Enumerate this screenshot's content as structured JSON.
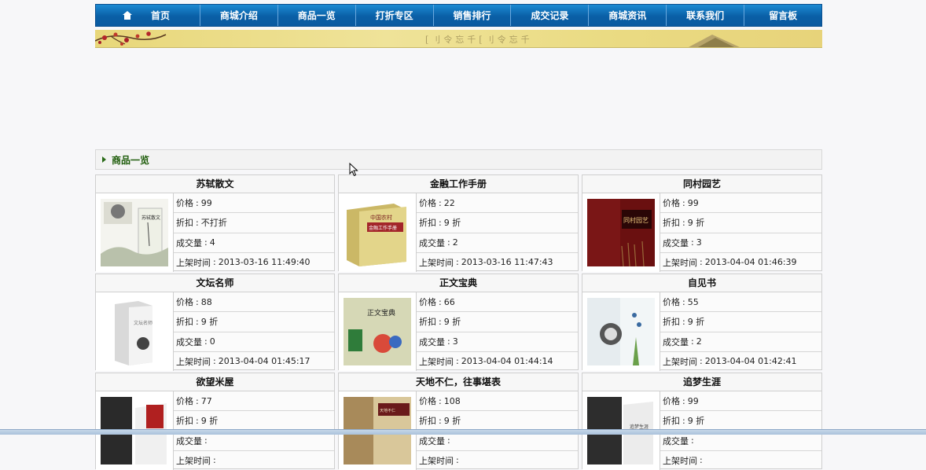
{
  "nav": {
    "items": [
      {
        "label": "首页",
        "icon": "home-icon"
      },
      {
        "label": "商城介绍"
      },
      {
        "label": "商品一览"
      },
      {
        "label": "打折专区"
      },
      {
        "label": "销售排行"
      },
      {
        "label": "成交记录"
      },
      {
        "label": "商城资讯"
      },
      {
        "label": "联系我们"
      },
      {
        "label": "留言板"
      }
    ],
    "color": "#0a5fa6"
  },
  "banner": {
    "motto": "[刂令忘千[刂令忘千"
  },
  "section": {
    "title": "商品一览",
    "icon": "arrow-right-icon"
  },
  "labels": {
    "price": "价格",
    "discount": "折扣",
    "sold": "成交量",
    "listed": "上架时间",
    "sep": ":"
  },
  "products": [
    {
      "title": "苏轼散文",
      "price": "99",
      "discount": "不打折",
      "sold": "4",
      "listed": "2013-03-16 11:49:40",
      "cover": "ink-landscape"
    },
    {
      "title": "金融工作手册",
      "price": "22",
      "discount": "9 折",
      "sold": "2",
      "listed": "2013-03-16 11:47:43",
      "cover": "yellow-book"
    },
    {
      "title": "同村园艺",
      "price": "99",
      "discount": "9 折",
      "sold": "3",
      "listed": "2013-04-04 01:46:39",
      "cover": "red-book"
    },
    {
      "title": "文坛名师",
      "price": "88",
      "discount": "9 折",
      "sold": "0",
      "listed": "2013-04-04 01:45:17",
      "cover": "white-book"
    },
    {
      "title": "正文宝典",
      "price": "66",
      "discount": "9 折",
      "sold": "3",
      "listed": "2013-04-04 01:44:14",
      "cover": "children-book"
    },
    {
      "title": "自见书",
      "price": "55",
      "discount": "9 折",
      "sold": "2",
      "listed": "2013-04-04 01:42:41",
      "cover": "light-book"
    },
    {
      "title": "欲望米屋",
      "price": "77",
      "discount": "9 折",
      "sold": "",
      "listed": "",
      "cover": "red-white-book"
    },
    {
      "title": "天地不仁，往事堪表",
      "price": "108",
      "discount": "9 折",
      "sold": "",
      "listed": "",
      "cover": "brown-book"
    },
    {
      "title": "追梦生涯",
      "price": "99",
      "discount": "9 折",
      "sold": "",
      "listed": "",
      "cover": "gray-book"
    }
  ]
}
